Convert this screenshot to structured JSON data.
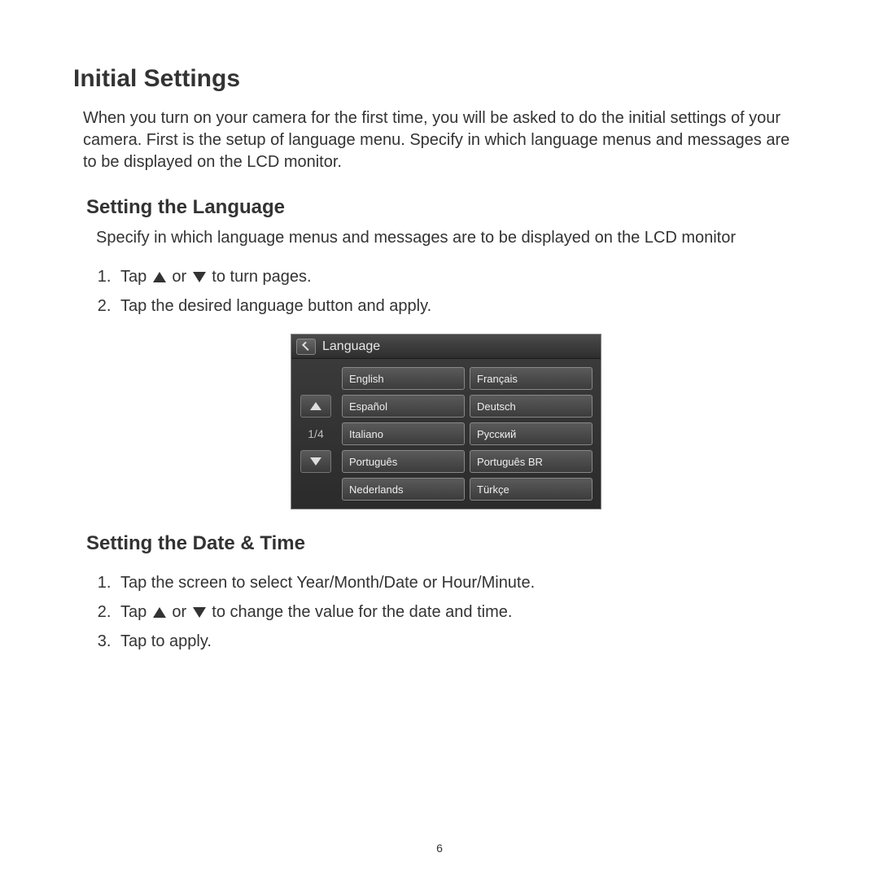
{
  "page": {
    "title": "Initial Settings",
    "intro": "When you turn on your camera for the first time, you will be asked to do the initial settings of your camera. First is the setup of language menu. Specify in which language menus and messages are to be displayed on the LCD monitor.",
    "page_number": "6"
  },
  "section_language": {
    "heading": "Setting the Language",
    "desc": "Specify in which language menus and messages are to be displayed on the LCD monitor",
    "steps": {
      "s1a": "Tap ",
      "s1mid": " or ",
      "s1b": " to turn pages.",
      "s2": "Tap the desired language button and apply."
    }
  },
  "screenshot": {
    "title": "Language",
    "page_indicator": "1/4",
    "languages": [
      "English",
      "Français",
      "Español",
      "Deutsch",
      "Italiano",
      "Русский",
      "Português",
      "Português BR",
      "Nederlands",
      "Türkçe"
    ]
  },
  "section_datetime": {
    "heading": "Setting the Date & Time",
    "steps": {
      "s1": "Tap the screen to select Year/Month/Date or Hour/Minute.",
      "s2a": "Tap ",
      "s2mid": " or ",
      "s2b": " to change the value for the date and time.",
      "s3": "Tap to apply."
    }
  }
}
